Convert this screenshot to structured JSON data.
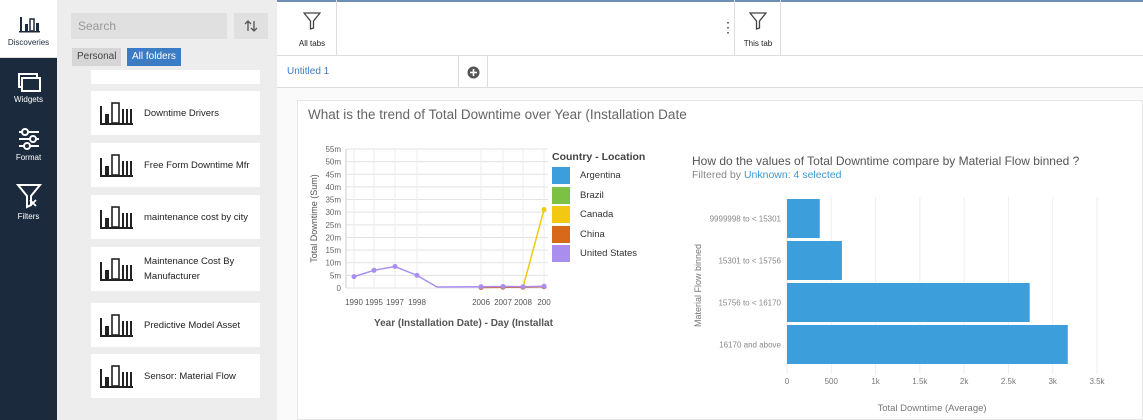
{
  "rail": {
    "items": [
      {
        "label": "Discoveries",
        "icon": "discoveries-icon"
      },
      {
        "label": "Widgets",
        "icon": "widgets-icon"
      },
      {
        "label": "Format",
        "icon": "format-icon"
      },
      {
        "label": "Filters",
        "icon": "filters-icon"
      }
    ]
  },
  "panel": {
    "search_placeholder": "Search",
    "filter_personal": "Personal",
    "filter_all": "All folders",
    "cards": [
      {
        "title": "Downtime Drivers",
        "icon": "bar-chart-icon"
      },
      {
        "title": "Free Form Downtime Mfr",
        "icon": "bar-chart-icon"
      },
      {
        "title": "maintenance cost by city",
        "icon": "bar-chart-icon"
      },
      {
        "title": "Maintenance Cost By Manufacturer",
        "icon": "bar-chart-icon"
      },
      {
        "title": "Predictive Model Asset",
        "icon": "bar-chart-icon"
      },
      {
        "title": "Sensor: Material Flow",
        "icon": "bar-chart-icon"
      }
    ]
  },
  "toolbar": {
    "all_tabs_label": "All tabs",
    "this_tab_label": "This tab",
    "more_label": "⋮"
  },
  "tabs": [
    {
      "label": "Untitled 1",
      "active": true
    }
  ],
  "colors": {
    "accent": "#3c7cc4",
    "rail": "#1b2a3d",
    "bar": "#3d9edc"
  },
  "chart_data": [
    {
      "type": "line",
      "title": "What is the trend of  Total Downtime  over  Year (Installation Date",
      "xlabel": "Year (Installation Date) - Day (Installat",
      "ylabel": "Total Downtime (Sum)",
      "ylim": [
        0,
        55000000
      ],
      "y_ticks": [
        "0",
        "5m",
        "10m",
        "15m",
        "20m",
        "25m",
        "30m",
        "35m",
        "40m",
        "45m",
        "50m",
        "55m"
      ],
      "x_ticks": [
        "1990",
        "1995",
        "1997",
        "1998",
        "2006",
        "2007",
        "2008",
        "200"
      ],
      "legend_title": "Country - Location",
      "grid": true,
      "legend_position": "right",
      "series": [
        {
          "name": "Argentina",
          "color": "#3d9edc",
          "points": []
        },
        {
          "name": "Brazil",
          "color": "#7cc144",
          "points": []
        },
        {
          "name": "Canada",
          "color": "#f2c811",
          "points": [
            {
              "x": "2006",
              "y": 300000
            },
            {
              "x": "2007",
              "y": 400000
            },
            {
              "x": "2008",
              "y": 300000
            },
            {
              "x": "200",
              "y": 31000000
            }
          ]
        },
        {
          "name": "China",
          "color": "#d9691a",
          "points": [
            {
              "x": "2006",
              "y": 200000
            },
            {
              "x": "2007",
              "y": 300000
            },
            {
              "x": "2008",
              "y": 300000
            },
            {
              "x": "200",
              "y": 500000
            }
          ]
        },
        {
          "name": "United States",
          "color": "#a98ef0",
          "points": [
            {
              "x": "1990",
              "y": 4500000
            },
            {
              "x": "1995",
              "y": 7000000
            },
            {
              "x": "1997",
              "y": 8500000
            },
            {
              "x": "1998",
              "y": 5000000
            },
            {
              "x": "1998.5",
              "y": 400000
            },
            {
              "x": "2006",
              "y": 500000
            },
            {
              "x": "2007",
              "y": 600000
            },
            {
              "x": "2008",
              "y": 500000
            },
            {
              "x": "200",
              "y": 700000
            }
          ]
        }
      ]
    },
    {
      "type": "bar",
      "orientation": "horizontal",
      "title": "How do the values of  Total Downtime  compare by  Material Flow binned  ?",
      "filter_prefix": "Filtered by",
      "filter_link": "Unknown: 4 selected",
      "xlabel": "Total Downtime (Average)",
      "ylabel": "Material Flow binned",
      "xlim": [
        0,
        3500
      ],
      "x_ticks": [
        "0",
        "500",
        "1k",
        "1.5k",
        "2k",
        "2.5k",
        "3k",
        "3.5k"
      ],
      "grid": true,
      "categories": [
        "9999998 to < 15301",
        "15301 to < 15756",
        "15756 to < 16170",
        "16170 and above"
      ],
      "values": [
        370,
        620,
        2740,
        3170
      ]
    }
  ]
}
